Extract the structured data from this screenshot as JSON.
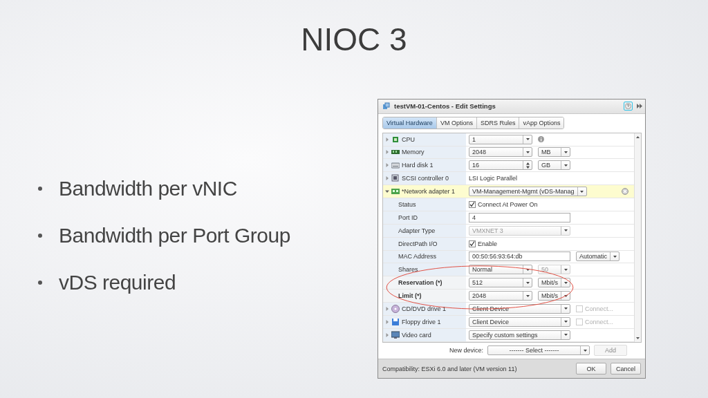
{
  "slide": {
    "title": "NIOC 3",
    "bullets": [
      "Bandwidth per vNIC",
      "Bandwidth per Port Group",
      "vDS required"
    ]
  },
  "dialog": {
    "title": "testVM-01-Centos - Edit Settings",
    "tabs": [
      {
        "label": "Virtual Hardware",
        "selected": true
      },
      {
        "label": "VM Options",
        "selected": false
      },
      {
        "label": "SDRS Rules",
        "selected": false
      },
      {
        "label": "vApp Options",
        "selected": false
      }
    ],
    "rows": [
      {
        "kind": "device",
        "label": "CPU",
        "expanded": false,
        "selected": false,
        "controls": [
          {
            "kind": "combo",
            "value": "1",
            "disabled": false
          },
          {
            "kind": "info"
          }
        ]
      },
      {
        "kind": "device",
        "label": "Memory",
        "expanded": false,
        "selected": false,
        "controls": [
          {
            "kind": "combo",
            "value": "2048",
            "disabled": false
          },
          {
            "kind": "combo",
            "value": "MB",
            "disabled": false
          }
        ]
      },
      {
        "kind": "device",
        "label": "Hard disk 1",
        "expanded": false,
        "selected": false,
        "controls": [
          {
            "kind": "spin",
            "value": "16"
          },
          {
            "kind": "combo",
            "value": "GB",
            "disabled": false
          }
        ]
      },
      {
        "kind": "device",
        "label": "SCSI controller 0",
        "expanded": false,
        "selected": false,
        "controls": [
          {
            "kind": "plain",
            "text": "LSI Logic Parallel"
          }
        ]
      },
      {
        "kind": "device",
        "label": "*Network adapter 1",
        "expanded": true,
        "selected": true,
        "controls": [
          {
            "kind": "combo",
            "value": "VM-Management-Mgmt (vDS-Manag",
            "disabled": false
          },
          {
            "kind": "remove"
          }
        ]
      },
      {
        "kind": "setting",
        "label": "Status",
        "bold": false,
        "controls": [
          {
            "kind": "check",
            "label": "Connect At Power On",
            "checked": true,
            "disabled": false
          }
        ]
      },
      {
        "kind": "setting",
        "label": "Port ID",
        "bold": false,
        "controls": [
          {
            "kind": "text",
            "value": "4"
          }
        ]
      },
      {
        "kind": "setting",
        "label": "Adapter Type",
        "bold": false,
        "controls": [
          {
            "kind": "combo",
            "value": "VMXNET 3",
            "disabled": true
          }
        ]
      },
      {
        "kind": "setting",
        "label": "DirectPath I/O",
        "bold": false,
        "controls": [
          {
            "kind": "check",
            "label": "Enable",
            "checked": true,
            "disabled": false
          }
        ]
      },
      {
        "kind": "setting",
        "label": "MAC Address",
        "bold": false,
        "controls": [
          {
            "kind": "text",
            "value": "00:50:56:93:64:db"
          },
          {
            "kind": "combo",
            "value": "Automatic",
            "disabled": false
          }
        ]
      },
      {
        "kind": "setting",
        "label": "Shares",
        "bold": false,
        "controls": [
          {
            "kind": "combo",
            "value": "Normal",
            "disabled": false
          },
          {
            "kind": "combo",
            "value": "50",
            "disabled": true
          }
        ]
      },
      {
        "kind": "setting",
        "label": "Reservation (*)",
        "bold": true,
        "controls": [
          {
            "kind": "combo",
            "value": "512",
            "disabled": false
          },
          {
            "kind": "combo",
            "value": "Mbit/s",
            "disabled": false
          }
        ]
      },
      {
        "kind": "setting",
        "label": "Limit (*)",
        "bold": true,
        "controls": [
          {
            "kind": "combo",
            "value": "2048",
            "disabled": false
          },
          {
            "kind": "combo",
            "value": "Mbit/s",
            "disabled": false
          }
        ]
      },
      {
        "kind": "device",
        "label": "CD/DVD drive 1",
        "expanded": false,
        "selected": false,
        "controls": [
          {
            "kind": "combo",
            "value": "Client Device",
            "disabled": false
          },
          {
            "kind": "check",
            "label": "Connect...",
            "checked": false,
            "disabled": true
          }
        ]
      },
      {
        "kind": "device",
        "label": "Floppy drive 1",
        "expanded": false,
        "selected": false,
        "controls": [
          {
            "kind": "combo",
            "value": "Client Device",
            "disabled": false
          },
          {
            "kind": "check",
            "label": "Connect...",
            "checked": false,
            "disabled": true
          }
        ]
      },
      {
        "kind": "device",
        "label": "Video card",
        "expanded": false,
        "selected": false,
        "controls": [
          {
            "kind": "combo",
            "value": "Specify custom settings",
            "disabled": false
          }
        ]
      }
    ],
    "new_device": {
      "label": "New device:",
      "select": "------- Select -------",
      "add_button": {
        "label": "Add",
        "disabled": true
      }
    },
    "compatibility": "Compatibility: ESXi 6.0 and later (VM version 11)",
    "buttons": [
      "OK",
      "Cancel"
    ]
  }
}
